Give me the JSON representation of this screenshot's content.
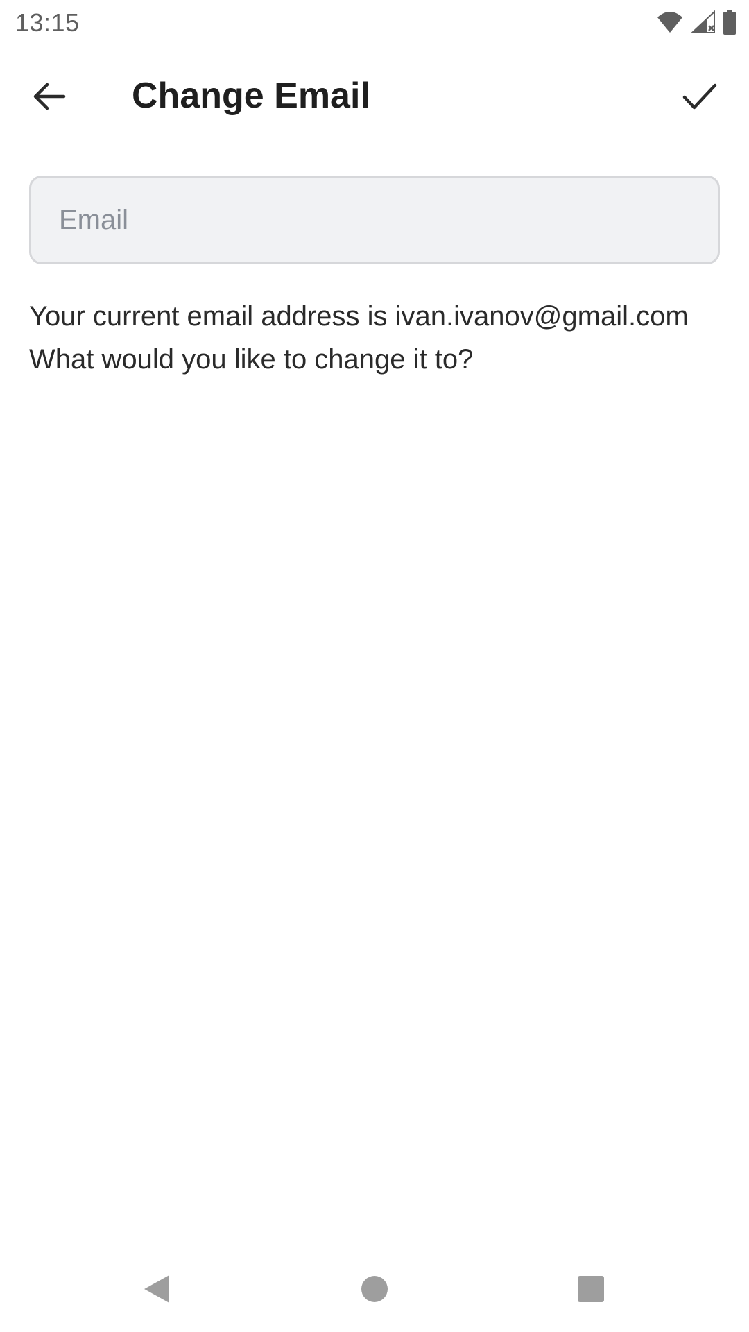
{
  "status_bar": {
    "time": "13:15",
    "icons": [
      "wifi-icon",
      "signal-icon",
      "battery-icon"
    ]
  },
  "app_bar": {
    "title": "Change Email",
    "back_icon": "arrow-left-icon",
    "confirm_icon": "check-icon"
  },
  "form": {
    "email_placeholder": "Email",
    "email_value": "",
    "description": "Your current email address is ivan.ivanov@gmail.com What would you like to change it to?"
  },
  "nav_bar": {
    "icons": [
      "nav-back-icon",
      "nav-home-icon",
      "nav-recents-icon"
    ]
  },
  "colors": {
    "input_background": "#f1f2f4",
    "input_border": "#d6d7da",
    "placeholder": "#8a8f98",
    "text_primary": "#1f1f1f",
    "icon_gray": "#5f5f5f"
  }
}
